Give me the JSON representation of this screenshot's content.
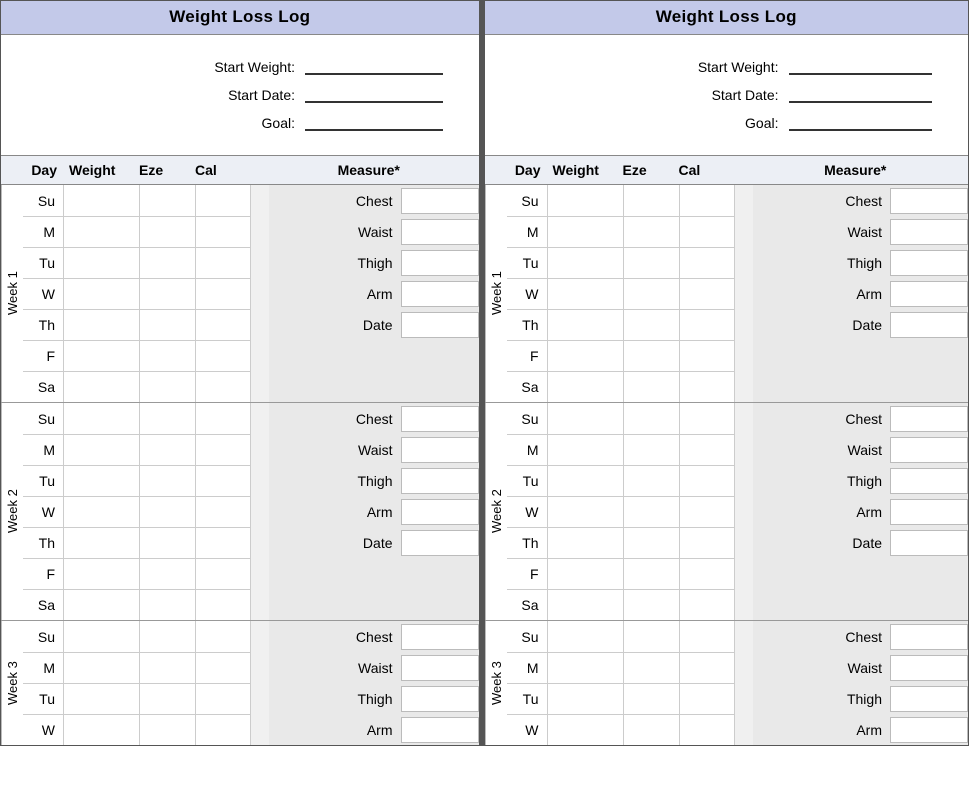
{
  "title": "Weight Loss Log",
  "meta": {
    "start_weight_label": "Start Weight:",
    "start_date_label": "Start Date:",
    "goal_label": "Goal:"
  },
  "headers": {
    "day": "Day",
    "weight": "Weight",
    "eze": "Eze",
    "cal": "Cal",
    "measure": "Measure*"
  },
  "days": [
    "Su",
    "M",
    "Tu",
    "W",
    "Th",
    "F",
    "Sa"
  ],
  "days_short4": [
    "Su",
    "M",
    "Tu",
    "W"
  ],
  "measures": [
    "Chest",
    "Waist",
    "Thigh",
    "Arm",
    "Date"
  ],
  "measures_short4": [
    "Chest",
    "Waist",
    "Thigh",
    "Arm"
  ],
  "weeks": {
    "w1": "Week 1",
    "w2": "Week 2",
    "w3": "Week 3"
  }
}
